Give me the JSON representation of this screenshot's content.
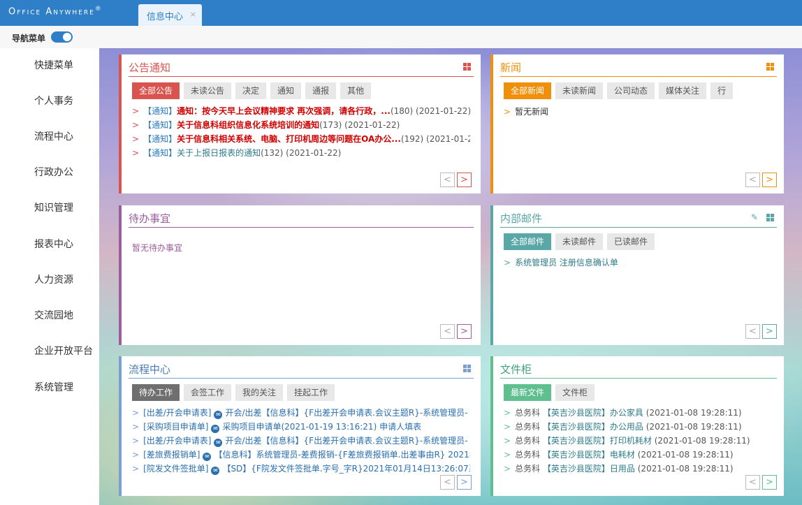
{
  "app": {
    "brand": "Office Anywhere",
    "brand_mark": "®",
    "active_tab": "信息中心",
    "tab_close": "×",
    "nav_toggle_label": "导航菜单"
  },
  "sidebar": {
    "items": [
      "快捷菜单",
      "个人事务",
      "流程中心",
      "行政办公",
      "知识管理",
      "报表中心",
      "人力资源",
      "交流园地",
      "企业开放平台",
      "系统管理"
    ]
  },
  "panels": {
    "notice": {
      "title": "公告通知",
      "tabs": [
        "全部公告",
        "未读公告",
        "决定",
        "通知",
        "通报",
        "其他"
      ],
      "items": [
        {
          "tag": "【通知】",
          "title": "通知：按今天早上会议精神要求 再次强调，请各行政，...",
          "meta": "(180) (2021-01-22)"
        },
        {
          "tag": "【通知】",
          "title": "关于信息科组织信息化系统培训的通知",
          "meta": "(173) (2021-01-22)"
        },
        {
          "tag": "【通知】",
          "title": "关于信息科相关系统、电脑、打印机周边等问题在OA办公...",
          "meta": "(192) (2021-01-20"
        },
        {
          "tag": "【通知】",
          "title": "关于上报日报表的通知",
          "meta": "(132) (2021-01-22)"
        }
      ],
      "arrow": ">",
      "prev": "<",
      "next": ">"
    },
    "news": {
      "title": "新闻",
      "tabs": [
        "全部新闻",
        "未读新闻",
        "公司动态",
        "媒体关注",
        "行"
      ],
      "empty": "暂无新闻",
      "arrow": ">",
      "prev": "<",
      "next": ">"
    },
    "todo": {
      "title": "待办事宜",
      "empty": "暂无待办事宜",
      "prev": "<",
      "next": ">"
    },
    "mail": {
      "title": "内部邮件",
      "tabs": [
        "全部邮件",
        "未读邮件",
        "已读邮件"
      ],
      "items": [
        {
          "text": "系统管理员 注册信息确认单"
        }
      ],
      "arrow": ">",
      "prev": "<",
      "next": ">"
    },
    "flow": {
      "title": "流程中心",
      "tabs": [
        "待办工作",
        "会签工作",
        "我的关注",
        "挂起工作"
      ],
      "items": [
        {
          "type": "[出差/开会申请表]",
          "text": "开会/出差【信息科】{F出差开会申请表.会议主题R}-系统管理员- 2"
        },
        {
          "type": "[采购项目申请单]",
          "text": "采购项目申请单(2021-01-19 13:16:21) 申请人填表"
        },
        {
          "type": "[出差/开会申请表]",
          "text": "开会/出差【信息科】{F出差开会申请表.会议主题R}-系统管理员- 2"
        },
        {
          "type": "[差旅费报销单]",
          "text": "【信息科】系统管理员-差费报销-{F差旅费报销单.出差事由R} 2021年"
        },
        {
          "type": "[院发文件签批单]",
          "text": "【SD】{F院发文件签批单.字号_字R}2021年01月14日13:26:07系统"
        }
      ],
      "arrow": ">",
      "prev": "<",
      "next": ">"
    },
    "files": {
      "title": "文件柜",
      "tabs": [
        "最新文件",
        "文件柜"
      ],
      "items": [
        {
          "dept": "总务科",
          "name": "【英吉沙县医院】办公家具",
          "date": "(2021-01-08 19:28:11)"
        },
        {
          "dept": "总务科",
          "name": "【英吉沙县医院】办公用品",
          "date": "(2021-01-08 19:28:11)"
        },
        {
          "dept": "总务科",
          "name": "【英吉沙县医院】打印机耗材",
          "date": "(2021-01-08 19:28:11)"
        },
        {
          "dept": "总务科",
          "name": "【英吉沙县医院】电耗材",
          "date": "(2021-01-08 19:28:11)"
        },
        {
          "dept": "总务科",
          "name": "【英吉沙县医院】日用品",
          "date": "(2021-01-08 19:28:11)"
        }
      ],
      "arrow": ">",
      "prev": "<",
      "next": ">"
    }
  },
  "colors": {
    "brand_blue": "#2f7ec8",
    "notice_red": "#d9534f",
    "news_orange": "#f0900a",
    "todo_purple": "#9b5e9b",
    "mail_teal": "#5aa7a7",
    "flow_blue": "#7a9fd0",
    "files_green": "#5fbf8f"
  }
}
